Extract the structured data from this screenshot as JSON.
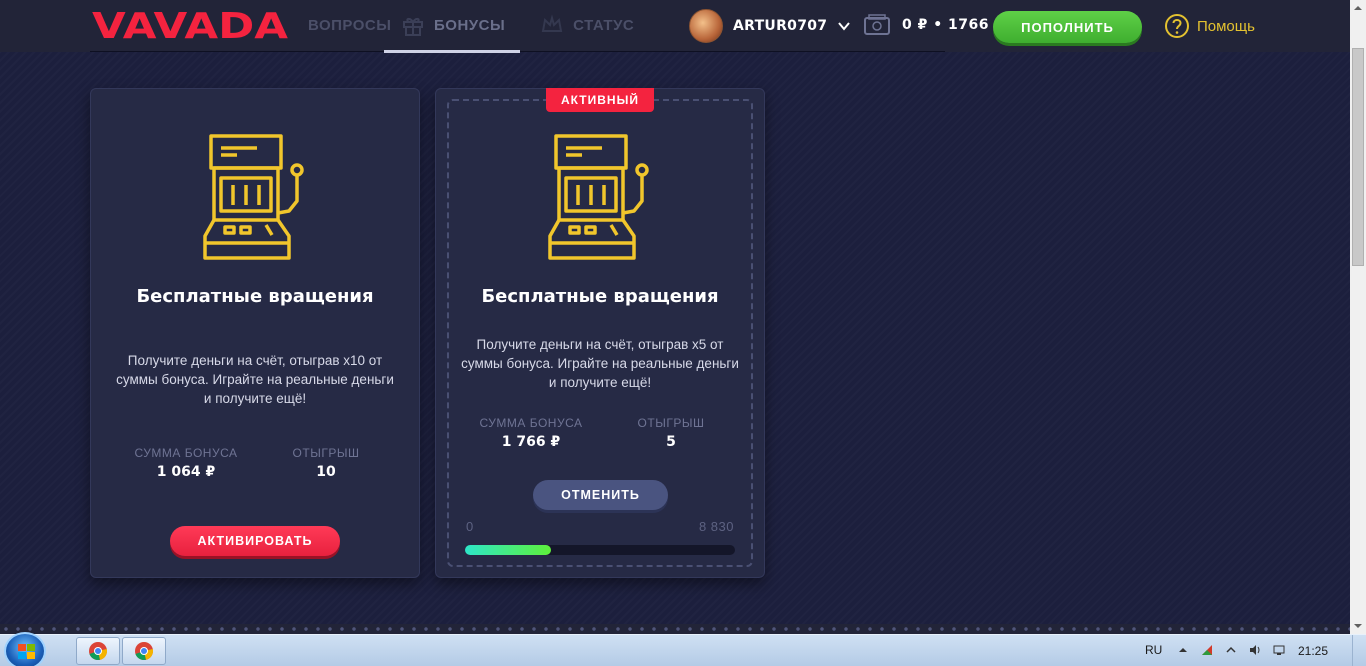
{
  "header": {
    "logo_text": "VAVADA",
    "tabs": [
      {
        "label": "ВОПРОСЫ",
        "icon": "question-icon",
        "active": false
      },
      {
        "label": "БОНУСЫ",
        "icon": "gift-icon",
        "active": true
      },
      {
        "label": "СТАТУС",
        "icon": "crown-icon",
        "active": false
      }
    ],
    "user": {
      "name": "ARTUR0707"
    },
    "wallet": {
      "balance": "0 ₽ • 1766"
    },
    "deposit_label": "ПОПОЛНИТЬ",
    "help_label": "Помощь"
  },
  "cards": [
    {
      "title": "Бесплатные вращения",
      "description": "Получите деньги на счёт, отыграв х10 от суммы бонуса. Играйте на реальные деньги и получите ещё!",
      "bonus_label": "СУММА БОНУСА",
      "bonus_value": "1 064 ₽",
      "wager_label": "ОТЫГРЫШ",
      "wager_value": "10",
      "button_label": "АКТИВИРОВАТЬ"
    },
    {
      "badge": "АКТИВНЫЙ",
      "title": "Бесплатные вращения",
      "description": "Получите деньги на счёт, отыграв х5 от суммы бонуса. Играйте на реальные деньги и получите ещё!",
      "bonus_label": "СУММА БОНУСА",
      "bonus_value": "1 766 ₽",
      "wager_label": "ОТЫГРЫШ",
      "wager_value": "5",
      "button_label": "ОТМЕНИТЬ",
      "progress": {
        "min_label": "0",
        "max_label": "8 830",
        "fraction": 0.32
      }
    }
  ],
  "taskbar": {
    "language": "RU",
    "clock": "21:25",
    "apps": [
      "chrome-icon",
      "chrome-icon"
    ]
  },
  "colors": {
    "brand_red": "#f4233f",
    "accent_yellow": "#e4c230",
    "deposit_green": "#4fc23c",
    "background": "#1c1f3d"
  }
}
